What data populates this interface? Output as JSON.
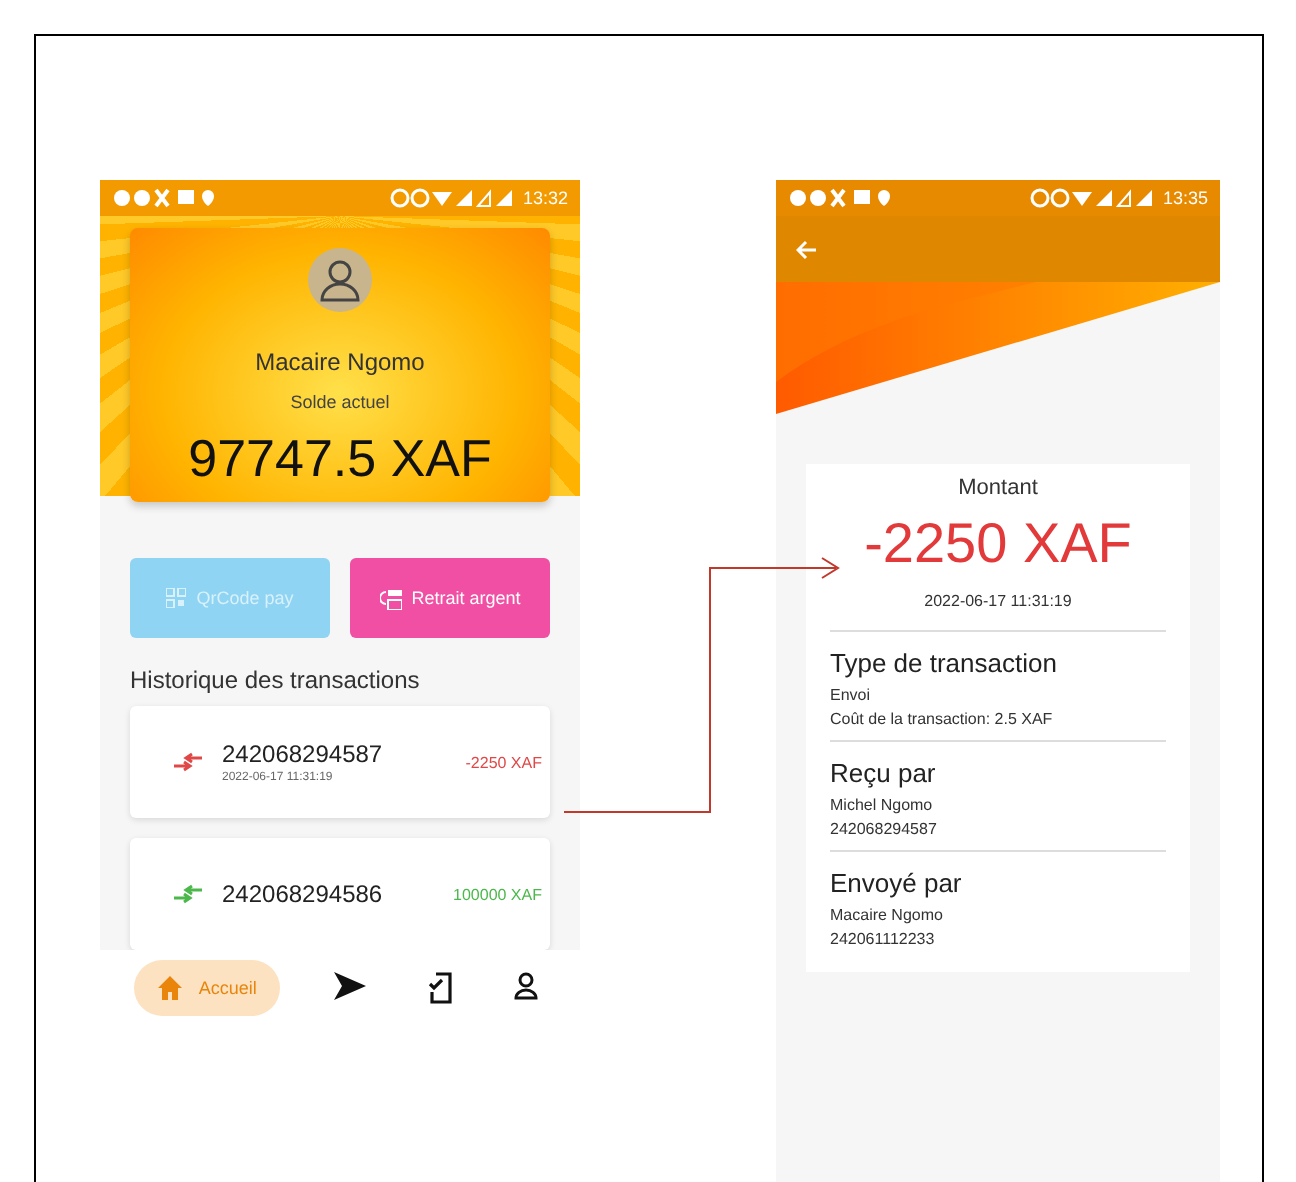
{
  "home_screen": {
    "status_bar": {
      "time": "13:32"
    },
    "profile": {
      "name": "Macaire Ngomo",
      "balance_label": "Solde actuel",
      "balance": "97747.5 XAF"
    },
    "buttons": [
      {
        "label": "QrCode pay",
        "kind": "qrcode"
      },
      {
        "label": "Retrait argent",
        "kind": "withdraw"
      }
    ],
    "history_title": "Historique des transactions",
    "transactions": [
      {
        "number": "242068294587",
        "date": "2022-06-17 11:31:19",
        "amount": "-2250 XAF",
        "kind": "out"
      },
      {
        "number": "242068294586",
        "amount": "100000 XAF",
        "kind": "in"
      }
    ],
    "nav": [
      {
        "kind": "home",
        "label": "Accueil",
        "selected": true
      },
      {
        "kind": "send",
        "selected": false
      },
      {
        "kind": "phone",
        "selected": false
      },
      {
        "kind": "profile",
        "selected": false
      }
    ]
  },
  "detail_screen": {
    "status_bar": {
      "time": "13:35"
    },
    "amount_label": "Montant",
    "amount": "-2250 XAF",
    "date": "2022-06-17 11:31:19",
    "sections": [
      {
        "title": "Type de transaction",
        "lines": [
          "Envoi",
          "Coût de la transaction: 2.5 XAF"
        ]
      },
      {
        "title": "Reçu par",
        "lines": [
          "Michel Ngomo",
          "242068294587"
        ]
      },
      {
        "title": "Envoyé par",
        "lines": [
          "Macaire Ngomo",
          "242061112233"
        ]
      }
    ]
  }
}
